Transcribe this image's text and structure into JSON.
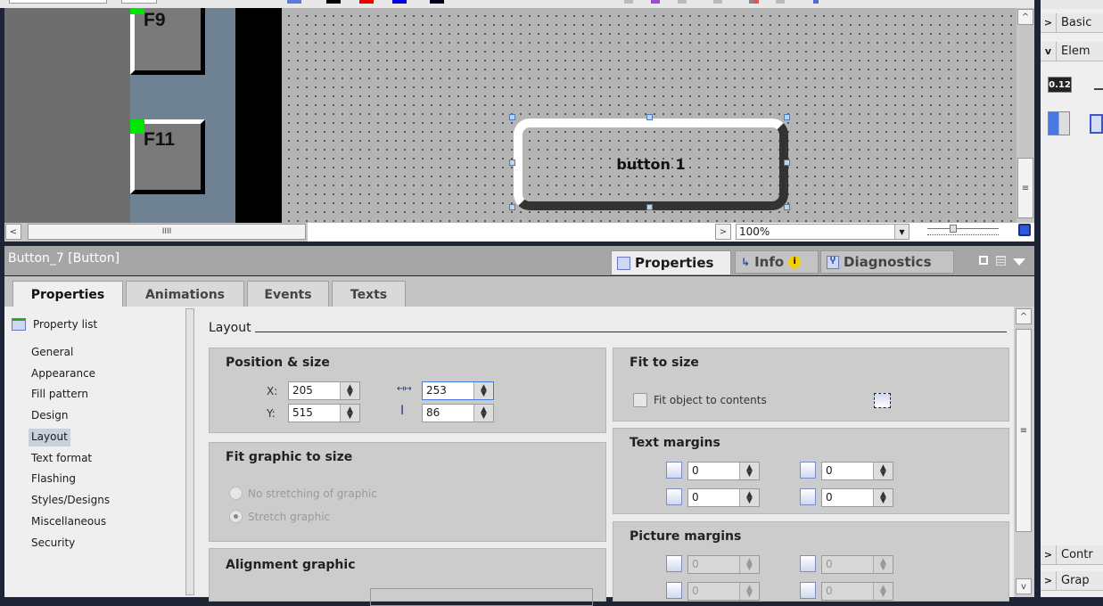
{
  "canvas": {
    "fkeys": [
      {
        "label": "F9"
      },
      {
        "label": "F11"
      }
    ],
    "selected_button_text": "button 1"
  },
  "zoombar": {
    "zoom_value": "100%"
  },
  "inspector": {
    "title": "Button_7 [Button]",
    "tabs": [
      {
        "label": "Properties",
        "icon": "properties-icon",
        "active": true
      },
      {
        "label": "Info",
        "icon": "info-icon",
        "active": false
      },
      {
        "label": "Diagnostics",
        "icon": "diagnostics-icon",
        "active": false
      }
    ],
    "sub_tabs": [
      "Properties",
      "Animations",
      "Events",
      "Texts"
    ],
    "property_list_label": "Property list",
    "nav_items": [
      "General",
      "Appearance",
      "Fill pattern",
      "Design",
      "Layout",
      "Text format",
      "Flashing",
      "Styles/Designs",
      "Miscellaneous",
      "Security"
    ],
    "selected_nav": "Layout",
    "section_title": "Layout",
    "position_size": {
      "title": "Position & size",
      "x_label": "X:",
      "x": "205",
      "y_label": "Y:",
      "y": "515",
      "width": "253",
      "height": "86"
    },
    "fit_graphic": {
      "title": "Fit graphic to size",
      "options": [
        "No stretching of graphic",
        "Stretch graphic"
      ],
      "selected": "Stretch graphic"
    },
    "alignment_graphic": {
      "title": "Alignment graphic"
    },
    "fit_to_size": {
      "title": "Fit to size",
      "checkbox_label": "Fit object to contents",
      "checked": false
    },
    "text_margins": {
      "title": "Text margins",
      "left": "0",
      "top": "0",
      "right": "0",
      "bottom": "0"
    },
    "picture_margins": {
      "title": "Picture margins",
      "left": "0",
      "top": "0",
      "right": "0",
      "bottom": "0"
    }
  },
  "right_pane": {
    "sections": [
      {
        "label": "Basic",
        "expanded": false
      },
      {
        "label": "Elem",
        "expanded": true
      },
      {
        "label": "Contr",
        "expanded": false
      },
      {
        "label": "Grap",
        "expanded": false
      }
    ],
    "element_icons": [
      "io-field-icon",
      "switch-icon",
      "symbolic-io-icon"
    ],
    "io_field_text": "0.12"
  },
  "colors": {
    "selection_handle": "#3d7be0",
    "led_green": "#00e600",
    "accent_blue": "#3d7be0"
  }
}
